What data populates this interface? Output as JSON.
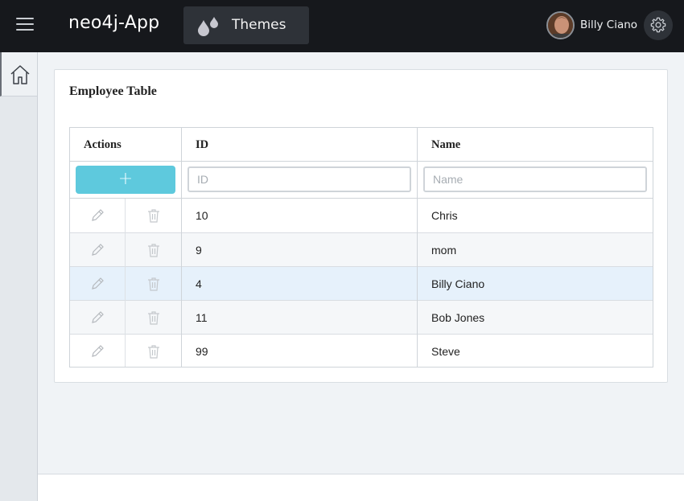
{
  "header": {
    "app_title": "neo4j-App",
    "themes_label": "Themes",
    "user_name": "Billy Ciano",
    "menu_icon": "hamburger-icon",
    "settings_icon": "gear-icon"
  },
  "sidebar": {
    "items": [
      {
        "icon": "home-icon",
        "active": true
      }
    ]
  },
  "card": {
    "title": "Employee Table"
  },
  "table": {
    "columns": [
      "Actions",
      "ID",
      "Name"
    ],
    "add_button_label": "+",
    "filters": {
      "id_placeholder": "ID",
      "name_placeholder": "Name"
    },
    "rows": [
      {
        "id": "10",
        "name": "Chris"
      },
      {
        "id": "9",
        "name": "mom"
      },
      {
        "id": "4",
        "name": "Billy Ciano"
      },
      {
        "id": "11",
        "name": "Bob Jones"
      },
      {
        "id": "99",
        "name": "Steve"
      }
    ],
    "selected_row": 2
  },
  "colors": {
    "topbar": "#16181c",
    "add_button": "#5ec9dd",
    "selected_row": "#e6f1fb"
  }
}
